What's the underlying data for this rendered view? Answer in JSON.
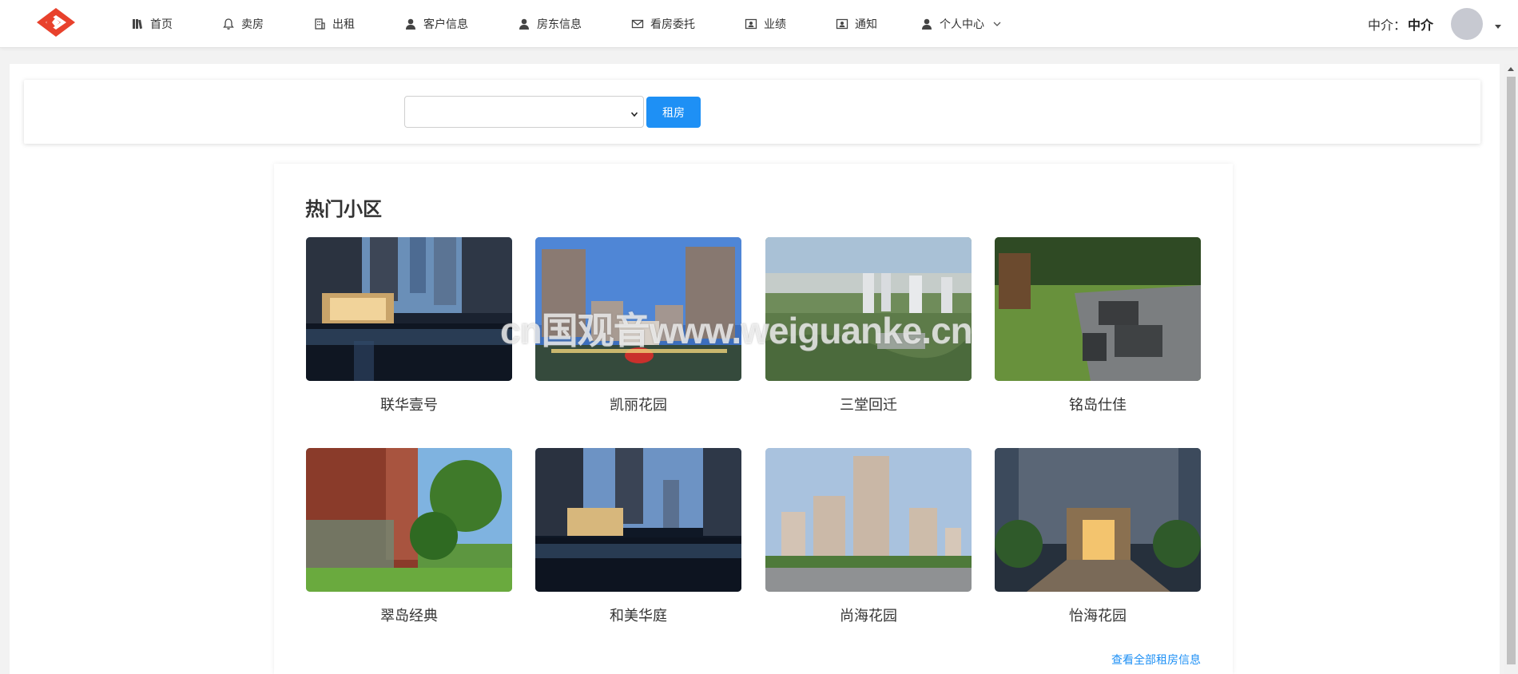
{
  "header": {
    "nav": [
      {
        "label": "首页",
        "icon": "home-book-icon"
      },
      {
        "label": "卖房",
        "icon": "bell-icon"
      },
      {
        "label": "出租",
        "icon": "building-icon"
      },
      {
        "label": "客户信息",
        "icon": "user-icon"
      },
      {
        "label": "房东信息",
        "icon": "user-icon"
      },
      {
        "label": "看房委托",
        "icon": "mail-icon"
      },
      {
        "label": "业绩",
        "icon": "id-card-icon"
      },
      {
        "label": "通知",
        "icon": "id-card-icon"
      },
      {
        "label": "个人中心",
        "icon": "user-icon"
      }
    ],
    "agent_prefix": "中介：",
    "agent_name": "中介"
  },
  "search": {
    "select_value": "",
    "button_label": "租房"
  },
  "hot": {
    "title": "热门小区",
    "communities": [
      {
        "name": "联华壹号"
      },
      {
        "name": "凯丽花园"
      },
      {
        "name": "三堂回迁"
      },
      {
        "name": "铭岛仕佳"
      },
      {
        "name": "翠岛经典"
      },
      {
        "name": "和美华庭"
      },
      {
        "name": "尚海花园"
      },
      {
        "name": "怡海花园"
      }
    ],
    "view_all": "查看全部租房信息"
  },
  "watermark": "cn国观音www.weiguanke.cn",
  "colors": {
    "accent": "#1e90f5",
    "logo": "#e8412c"
  }
}
